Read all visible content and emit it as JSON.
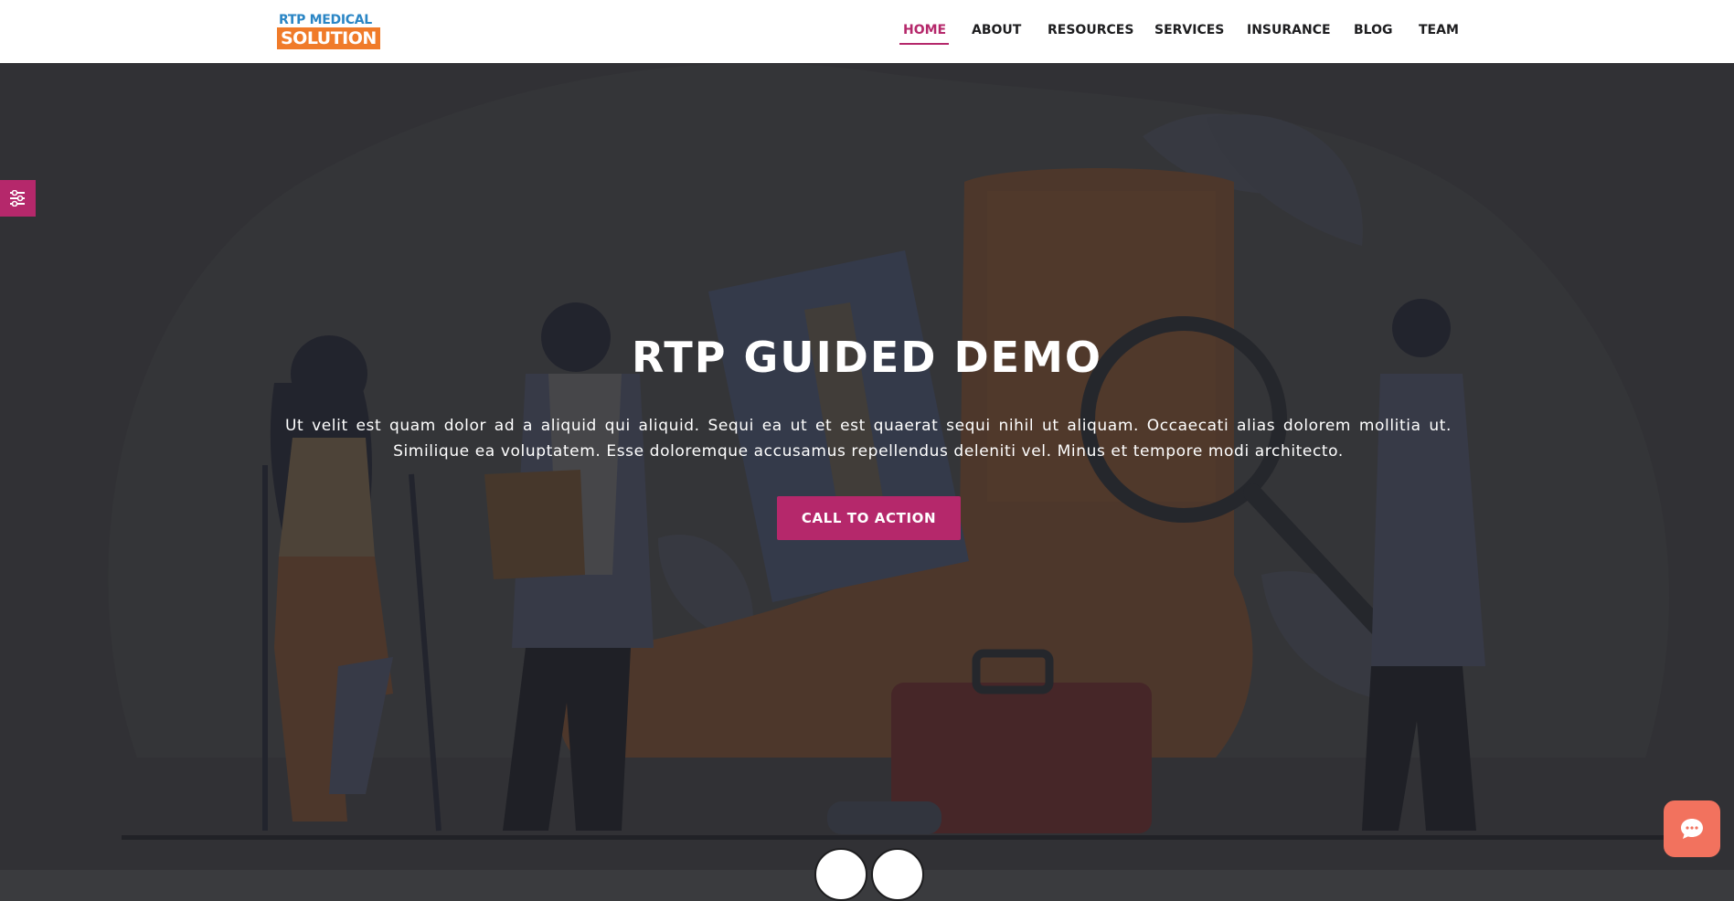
{
  "brand": {
    "logo_line1": "RTP MEDICAL",
    "logo_line2": "SOLUTION",
    "primary_color": "#b5286b",
    "logo_orange": "#f07b2a",
    "logo_blue": "#2b86c5"
  },
  "nav": {
    "items": [
      {
        "label": "HOME",
        "active": true
      },
      {
        "label": "ABOUT",
        "active": false
      },
      {
        "label": "RESOURCES",
        "active": false
      },
      {
        "label": "SERVICES",
        "active": false
      },
      {
        "label": "INSURANCE",
        "active": false
      },
      {
        "label": "BLOG",
        "active": false
      },
      {
        "label": "TEAM",
        "active": false
      }
    ]
  },
  "hero": {
    "title": "RTP GUIDED DEMO",
    "text": "Ut velit est quam dolor ad a aliquid qui aliquid. Sequi ea ut et est quaerat sequi nihil ut aliquam. Occaecati alias dolorem mollitia ut. Similique ea voluptatem. Esse doloremque accusamus repellendus deleniti vel. Minus et tempore modi architecto.",
    "cta_label": "CALL TO ACTION"
  },
  "widgets": {
    "side_tab_icon": "sliders-icon",
    "chat_icon": "chat-bubble-icon",
    "chat_color": "#f2725e"
  }
}
